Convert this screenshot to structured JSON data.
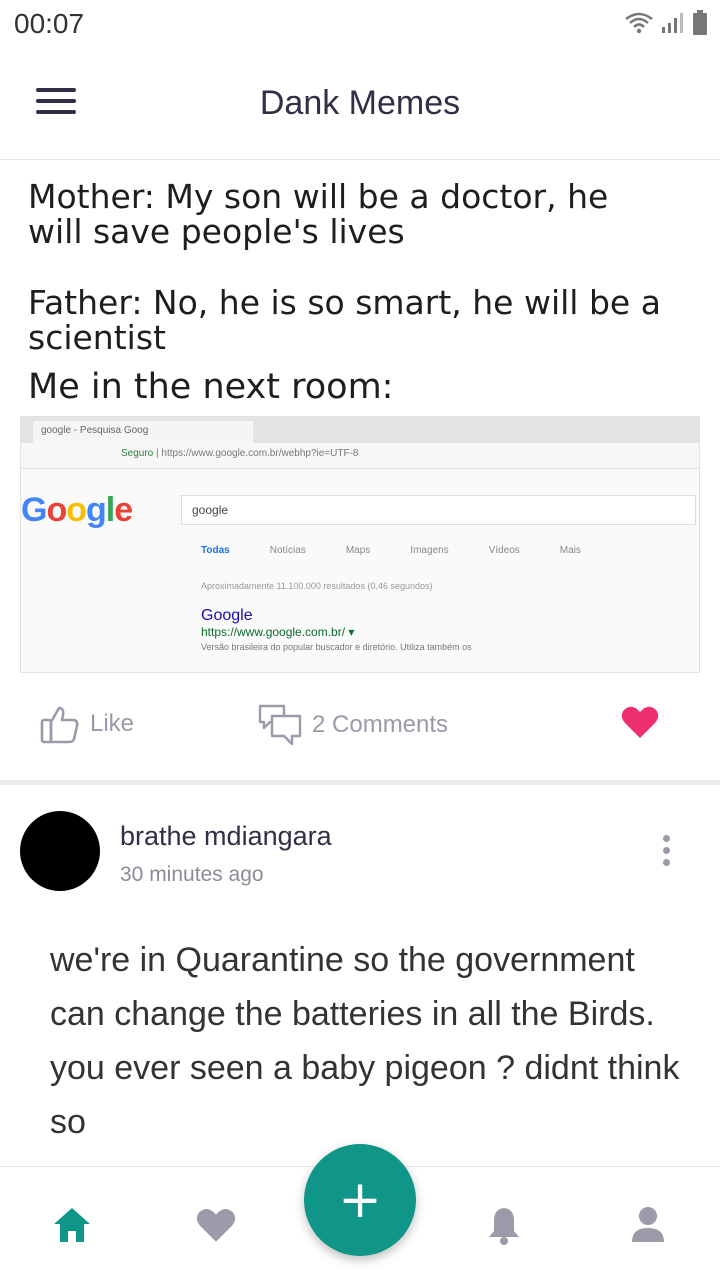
{
  "status_bar": {
    "time": "00:07"
  },
  "app_bar": {
    "title": "Dank Memes"
  },
  "meme": {
    "lines": [
      "Mother: My son will be a doctor, he",
      "will save people's lives",
      "Father: No, he is so smart, he will be a",
      "scientist",
      "Me in the next room:"
    ],
    "screenshot": {
      "tab": "google - Pesquisa Goog",
      "url_secure": "Seguro",
      "url": "https://www.google.com.br/webhp?ie=UTF-8",
      "logo": "Google",
      "query": "google",
      "tabs": [
        "Todas",
        "Notícias",
        "Maps",
        "Imagens",
        "Vídeos",
        "Mais"
      ],
      "count": "Aproximadamente 11.100.000 resultados (0,46 segundos)",
      "result_title": "Google",
      "result_url": "https://www.google.com.br/ ▾",
      "result_desc": "Versão brasileira do popular buscador e diretório. Utiliza também os"
    }
  },
  "actions": {
    "like_label": "Like",
    "comments_label": "2 Comments"
  },
  "post": {
    "author": "brathe mdiangara",
    "time": "30 minutes ago",
    "text": "we're in Quarantine so the government can change the batteries in all the Birds. you ever seen a baby pigeon ? didnt think so"
  },
  "fab": {
    "label": "+"
  },
  "colors": {
    "accent": "#0f9688",
    "heart": "#f0306e",
    "icon_gray": "#9a9aa8",
    "text_dark": "#2f3046"
  },
  "icons": {
    "nav": [
      "home-icon",
      "heart-icon",
      "bell-icon",
      "person-icon"
    ]
  }
}
